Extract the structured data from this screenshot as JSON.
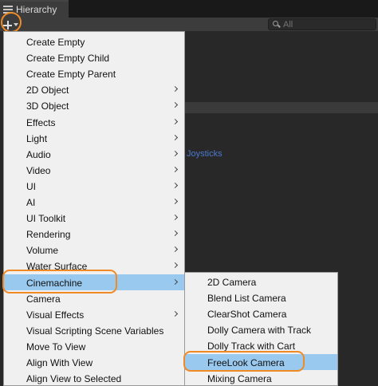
{
  "window": {
    "tab_title": "Hierarchy"
  },
  "toolbar": {
    "search_placeholder": "All"
  },
  "background": {
    "visible_text": "Joysticks"
  },
  "colors": {
    "accent_highlight": "#f08a24",
    "menu_selection": "#99c9ef"
  },
  "main_menu": [
    {
      "label": "Create Empty",
      "submenu": false
    },
    {
      "label": "Create Empty Child",
      "submenu": false
    },
    {
      "label": "Create Empty Parent",
      "submenu": false
    },
    {
      "label": "2D Object",
      "submenu": true
    },
    {
      "label": "3D Object",
      "submenu": true
    },
    {
      "label": "Effects",
      "submenu": true
    },
    {
      "label": "Light",
      "submenu": true
    },
    {
      "label": "Audio",
      "submenu": true
    },
    {
      "label": "Video",
      "submenu": true
    },
    {
      "label": "UI",
      "submenu": true
    },
    {
      "label": "AI",
      "submenu": true
    },
    {
      "label": "UI Toolkit",
      "submenu": true
    },
    {
      "label": "Rendering",
      "submenu": true
    },
    {
      "label": "Volume",
      "submenu": true
    },
    {
      "label": "Water Surface",
      "submenu": true
    },
    {
      "label": "Cinemachine",
      "submenu": true,
      "selected": true
    },
    {
      "label": "Camera",
      "submenu": false
    },
    {
      "label": "Visual Effects",
      "submenu": true
    },
    {
      "label": "Visual Scripting Scene Variables",
      "submenu": false
    },
    {
      "label": "Move To View",
      "submenu": false
    },
    {
      "label": "Align With View",
      "submenu": false
    },
    {
      "label": "Align View to Selected",
      "submenu": false
    }
  ],
  "cinemachine_submenu": [
    {
      "label": "2D Camera"
    },
    {
      "label": "Blend List Camera"
    },
    {
      "label": "ClearShot Camera"
    },
    {
      "label": "Dolly Camera with Track"
    },
    {
      "label": "Dolly Track with Cart"
    },
    {
      "label": "FreeLook Camera",
      "selected": true
    },
    {
      "label": "Mixing Camera"
    }
  ]
}
